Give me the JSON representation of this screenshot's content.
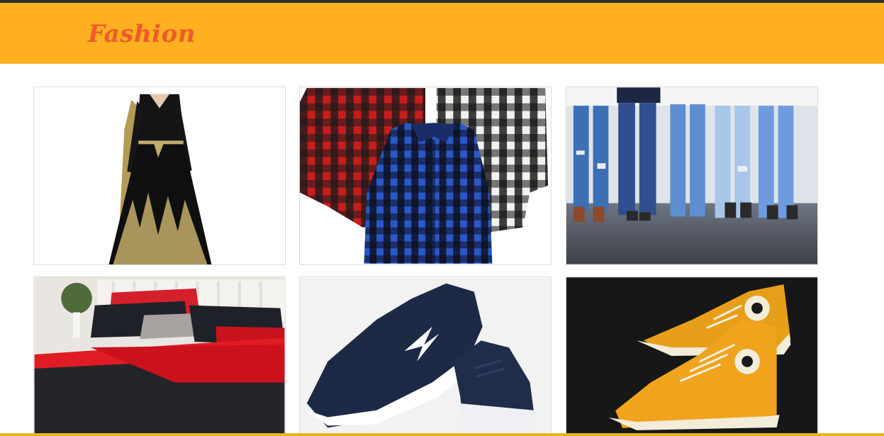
{
  "brand": {
    "logo_text": "Fashion"
  },
  "colors": {
    "header_bg": "#ffb020",
    "logo": "#ef5a2a",
    "top_strip": "#2d2d2d"
  },
  "products": [
    {
      "id": "dress",
      "image": "black-embroidered-gown-image"
    },
    {
      "id": "shirts",
      "image": "checked-shirts-image"
    },
    {
      "id": "jeans",
      "image": "jeans-models-image"
    },
    {
      "id": "bedding",
      "image": "bed-sheet-set-image"
    },
    {
      "id": "sneakers",
      "image": "navy-sport-shoes-image"
    },
    {
      "id": "converse",
      "image": "yellow-high-top-sneakers-image"
    }
  ]
}
